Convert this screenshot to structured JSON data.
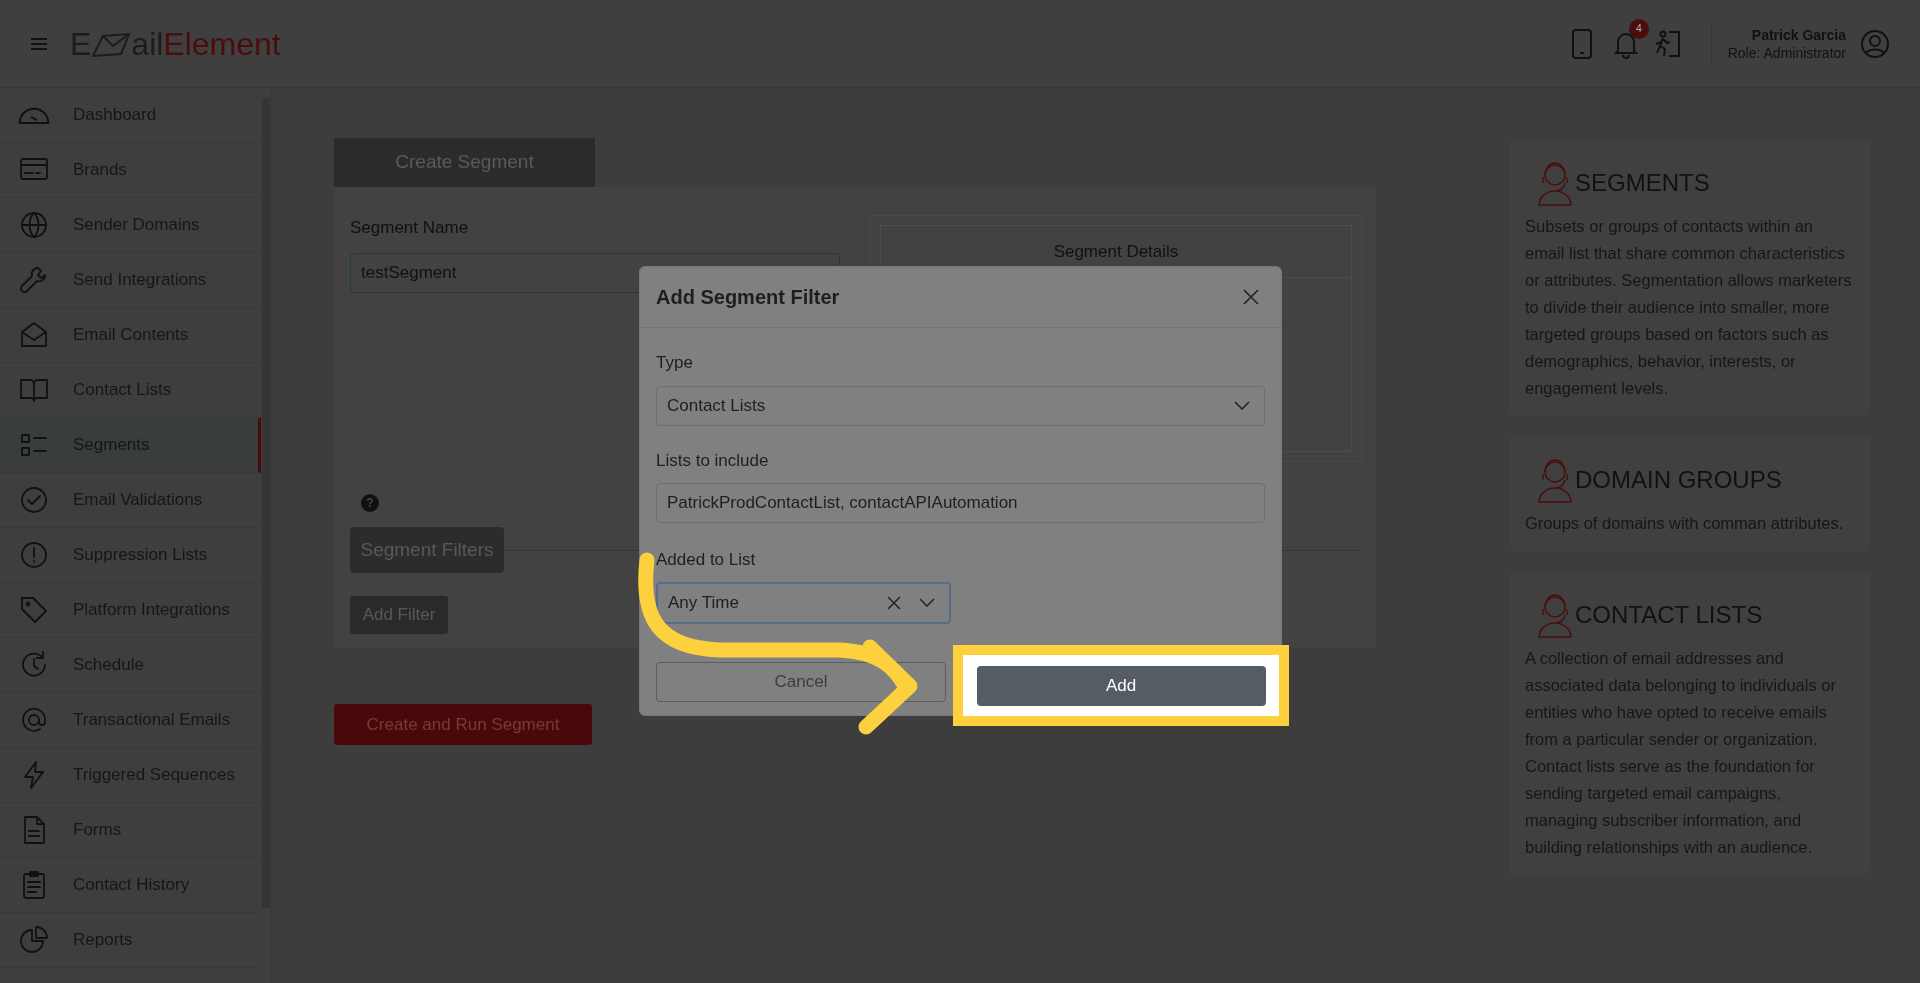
{
  "header": {
    "logo": {
      "first": "E",
      "middle": "ail",
      "brand": "Element"
    },
    "notification_count": "4",
    "user_name": "Patrick Garcia",
    "user_role": "Role: Administrator"
  },
  "sidebar": {
    "items": [
      {
        "label": "Dashboard",
        "selected": false
      },
      {
        "label": "Brands",
        "selected": false
      },
      {
        "label": "Sender Domains",
        "selected": false
      },
      {
        "label": "Send Integrations",
        "selected": false
      },
      {
        "label": "Email Contents",
        "selected": false
      },
      {
        "label": "Contact Lists",
        "selected": false
      },
      {
        "label": "Segments",
        "selected": true
      },
      {
        "label": "Email Validations",
        "selected": false
      },
      {
        "label": "Suppression Lists",
        "selected": false
      },
      {
        "label": "Platform Integrations",
        "selected": false
      },
      {
        "label": "Schedule",
        "selected": false
      },
      {
        "label": "Transactional Emails",
        "selected": false
      },
      {
        "label": "Triggered Sequences",
        "selected": false
      },
      {
        "label": "Forms",
        "selected": false
      },
      {
        "label": "Contact History",
        "selected": false
      },
      {
        "label": "Reports",
        "selected": false
      }
    ]
  },
  "main": {
    "tab": "Create Segment",
    "segment_name_label": "Segment Name",
    "segment_name_value": "testSegment",
    "details_title": "Segment Details",
    "help_mark": "?",
    "filters_button": "Segment Filters",
    "add_filter_button": "Add Filter",
    "create_button": "Create and Run Segment"
  },
  "modal": {
    "title": "Add Segment Filter",
    "type_label": "Type",
    "type_value": "Contact Lists",
    "lists_label": "Lists to include",
    "lists_value": "PatrickProdContactList, contactAPIAutomation",
    "added_label": "Added to List",
    "added_value": "Any Time",
    "cancel_button": "Cancel",
    "add_button": "Add"
  },
  "info_cards": [
    {
      "title": "SEGMENTS",
      "text": "Subsets or groups of contacts within an email list that share common characteristics or attributes. Segmentation allows marketers to divide their audience into smaller, more targeted groups based on factors such as demographics, behavior, interests, or engagement levels."
    },
    {
      "title": "DOMAIN GROUPS",
      "text": "Groups of domains with comman attributes."
    },
    {
      "title": "CONTACT LISTS",
      "text": "A collection of email addresses and associated data belonging to individuals or entities who have opted to receive emails from a particular sender or organization. Contact lists serve as the foundation for sending targeted email campaigns, managing subscriber information, and building relationships with an audience."
    }
  ]
}
